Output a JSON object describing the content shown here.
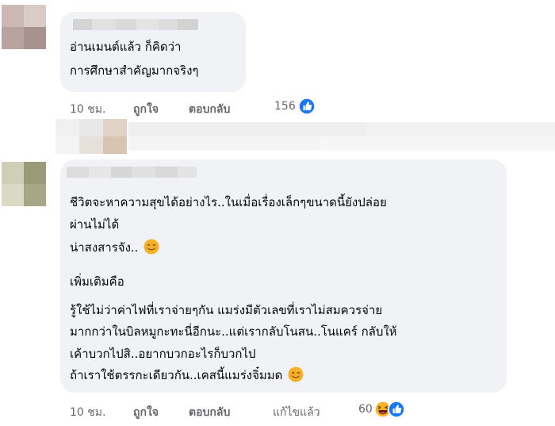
{
  "comments": [
    {
      "text_lines": [
        "อ่านเมนต์แล้ว ก็คิดว่า",
        "การศึกษาสำคัญมากจริงๆ"
      ],
      "time": "10 ชม.",
      "like_label": "ถูกใจ",
      "reply_label": "ตอบกลับ",
      "reaction_count": "156",
      "reaction_icon": "like-icon"
    },
    {
      "text_lines": [
        "ชีวิตจะหาความสุขได้อย่างไร..ในเมื่อเรื่องเล็กๆขนาดนี้ยังปล่อย",
        "ผ่านไม่ได้",
        "น่าสงสารจัง..",
        "เพิ่มเติมคือ",
        "รู้ใช้ไม่ว่าค่าไฟที่เราจ่ายๆกัน แมร่งมีตัวเลขที่เราไม่สมควรจ่าย",
        "มากกว่าในบิลหมูกะทะนี่อีกนะ..แต่เรากลับโนสน..โนแคร์ กลับให้",
        "เค้าบวกไปสิ..อยากบวกอะไรก็บวกไป",
        "ถ้าเราใช้ตรรกะเดียวกัน..เคสนี้แมร่งจิ๋มมด"
      ],
      "inline_emoji": "smiling-face-icon",
      "time": "10 ชม.",
      "like_label": "ถูกใจ",
      "reply_label": "ตอบกลับ",
      "edited_label": "แก้ไขแล้ว",
      "reaction_count": "60",
      "reaction_icons": [
        "laughing-face-icon",
        "like-icon"
      ]
    }
  ],
  "colors": {
    "bubble": "#f0f2f5",
    "secondary_text": "#65676b",
    "like_blue": "#1877f2",
    "emoji_yellow": "#f7b125"
  }
}
